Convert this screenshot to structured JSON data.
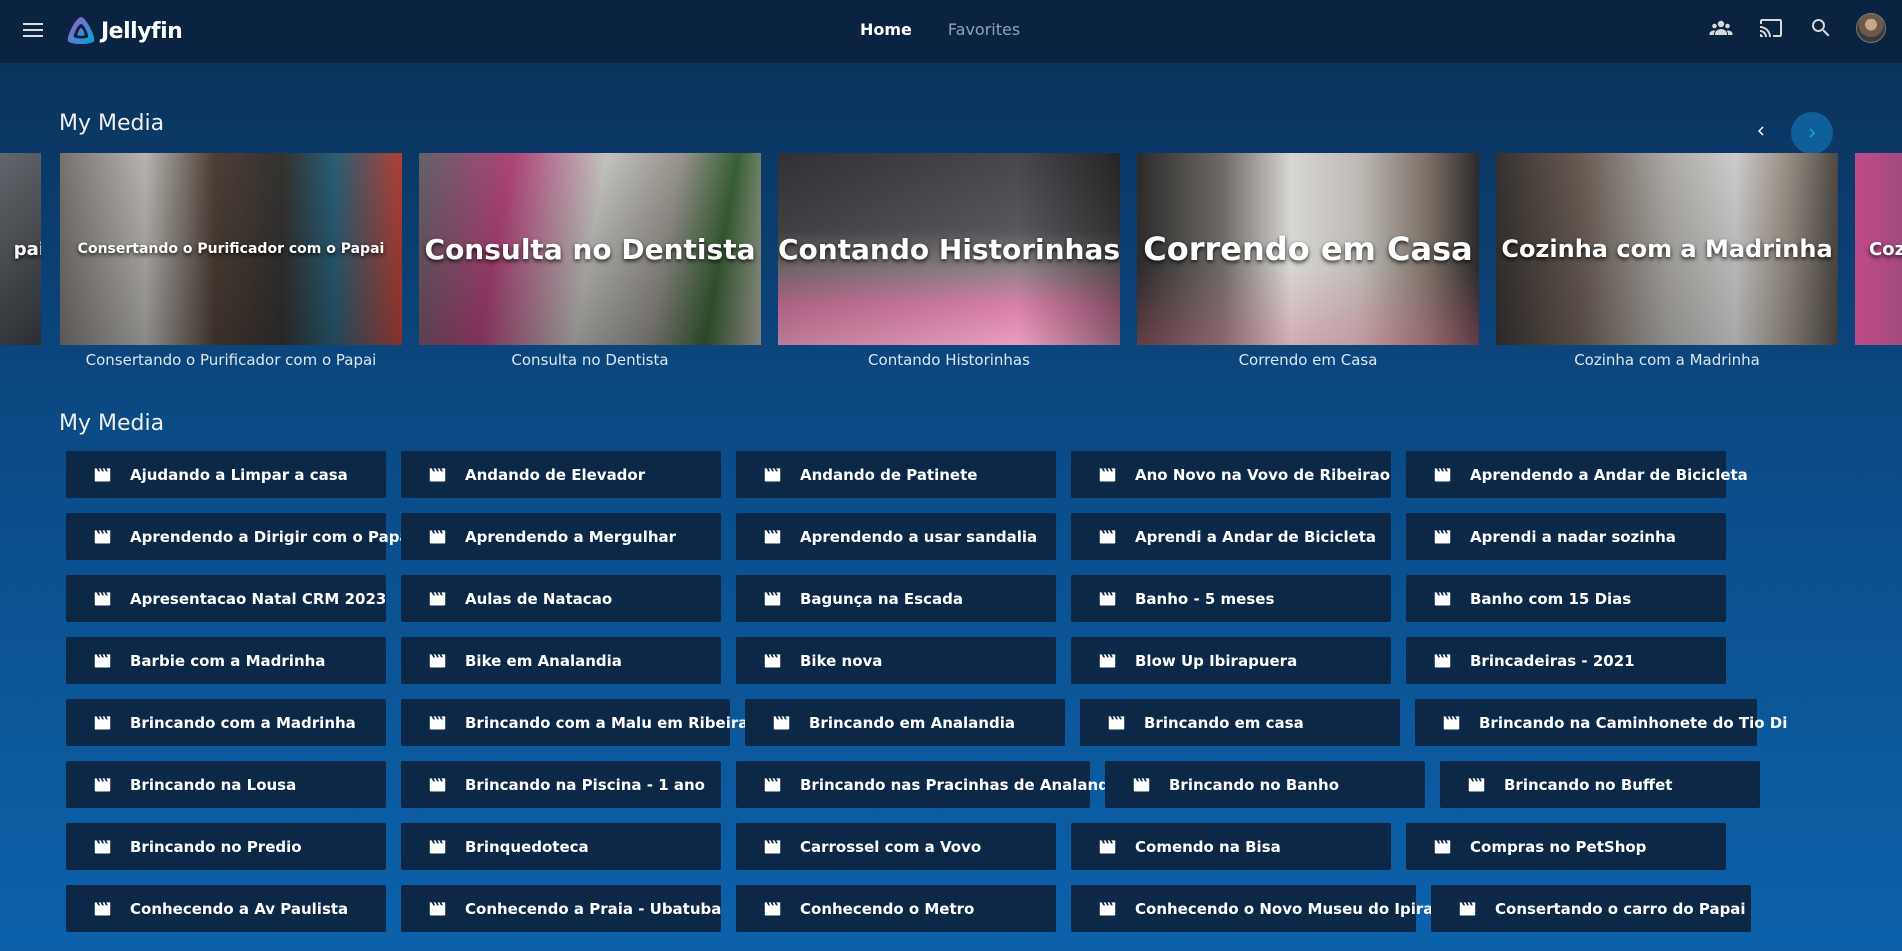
{
  "header": {
    "app_name": "Jellyfin",
    "tabs": [
      {
        "label": "Home"
      },
      {
        "label": "Favorites"
      }
    ]
  },
  "sections": [
    {
      "title": "My Media"
    },
    {
      "title": "My Media"
    }
  ],
  "carousel": [
    {
      "overlay": "pai",
      "caption": ""
    },
    {
      "overlay": "Consertando o Purificador com o Papai",
      "caption": "Consertando o Purificador com o Papai"
    },
    {
      "overlay": "Consulta no Dentista",
      "caption": "Consulta no Dentista"
    },
    {
      "overlay": "Contando Historinhas",
      "caption": "Contando Historinhas"
    },
    {
      "overlay": "Correndo em Casa",
      "caption": "Correndo em Casa"
    },
    {
      "overlay": "Cozinha com a Madrinha",
      "caption": "Cozinha com a Madrinha"
    },
    {
      "overlay": "Coz",
      "caption": ""
    }
  ],
  "library_rows": [
    [
      "Ajudando a Limpar a casa",
      "Andando de Elevador",
      "Andando de Patinete",
      "Ano Novo na Vovo de Ribeirao",
      "Aprendendo a Andar de Bicicleta"
    ],
    [
      "Aprendendo a Dirigir com o Papai",
      "Aprendendo a Mergulhar",
      "Aprendendo a usar sandalia",
      "Aprendi a Andar de Bicicleta",
      "Aprendi a nadar sozinha"
    ],
    [
      "Apresentacao Natal CRM 2023",
      "Aulas de Natacao",
      "Bagunça na Escada",
      "Banho - 5 meses",
      "Banho com 15 Dias"
    ],
    [
      "Barbie com a Madrinha",
      "Bike em Analandia",
      "Bike nova",
      "Blow Up Ibirapuera",
      "Brincadeiras - 2021"
    ],
    [
      "Brincando com a Madrinha",
      "Brincando com a Malu em Ribeirao",
      "Brincando em Analandia",
      "Brincando em casa",
      "Brincando na Caminhonete do Tio Di"
    ],
    [
      "Brincando na Lousa",
      "Brincando na Piscina - 1 ano",
      "Brincando nas Pracinhas de Analandia",
      "Brincando no Banho",
      "Brincando no Buffet"
    ],
    [
      "Brincando no Predio",
      "Brinquedoteca",
      "Carrossel com a Vovo",
      "Comendo na Bisa",
      "Compras no PetShop"
    ],
    [
      "Conhecendo a Av Paulista",
      "Conhecendo a Praia - Ubatuba",
      "Conhecendo o Metro",
      "Conhecendo o Novo Museu do Ipiranga",
      "Consertando o carro do Papai"
    ]
  ],
  "colors": {
    "header_bg": "#0a2340",
    "item_bg": "#0d2746",
    "accent": "#00a4dc",
    "logo_purple": "#aa5cc3"
  }
}
